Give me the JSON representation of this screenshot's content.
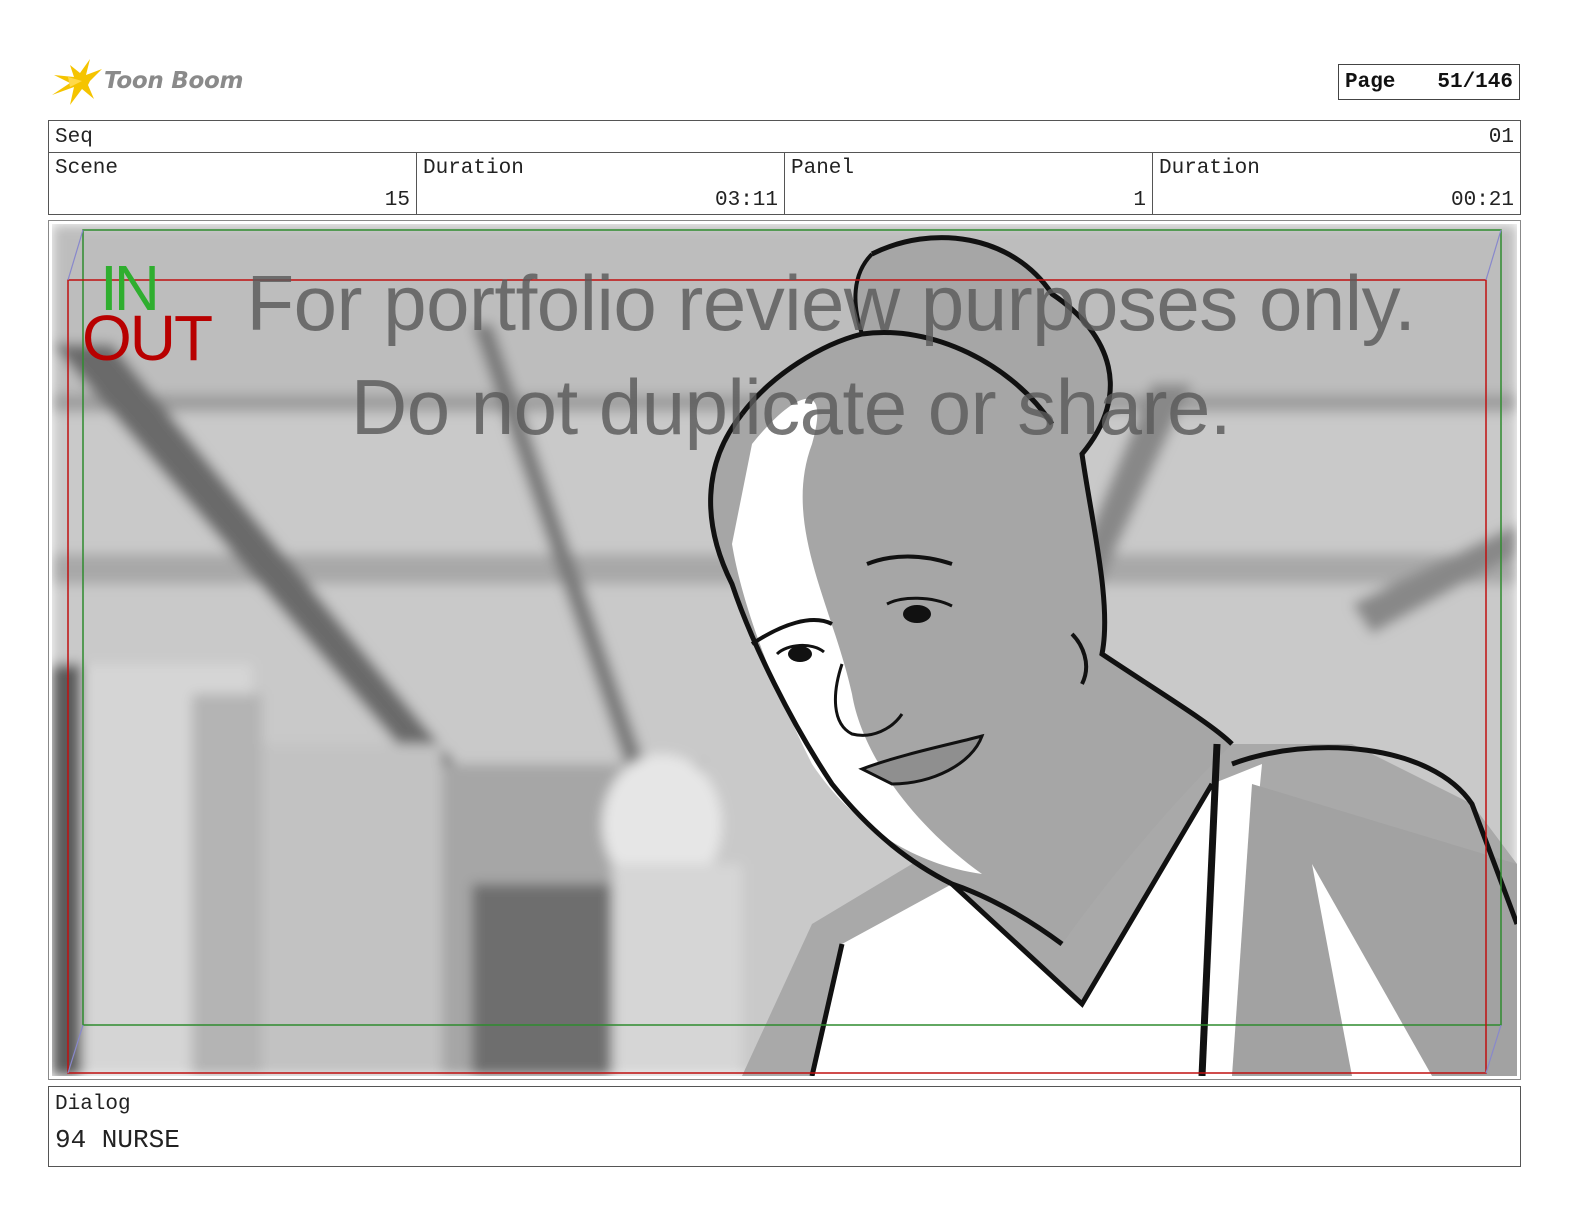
{
  "header": {
    "logo_text": "Toon Boom",
    "page_label": "Page",
    "page_value": "51/146"
  },
  "info": {
    "seq_label": "Seq",
    "seq_value": "01",
    "scene_label": "Scene",
    "scene_value": "15",
    "scene_duration_label": "Duration",
    "scene_duration_value": "03:11",
    "panel_label": "Panel",
    "panel_value": "1",
    "panel_duration_label": "Duration",
    "panel_duration_value": "00:21"
  },
  "panel": {
    "in_label": "IN",
    "out_label": "OUT",
    "watermark_line1": "For portfolio review purposes only.",
    "watermark_line2": "Do not duplicate or share."
  },
  "dialog": {
    "label": "Dialog",
    "text": "94 NURSE"
  },
  "colors": {
    "in_frame": "#2e8b2e",
    "out_frame": "#c01010",
    "logo_star": "#f5c400"
  }
}
